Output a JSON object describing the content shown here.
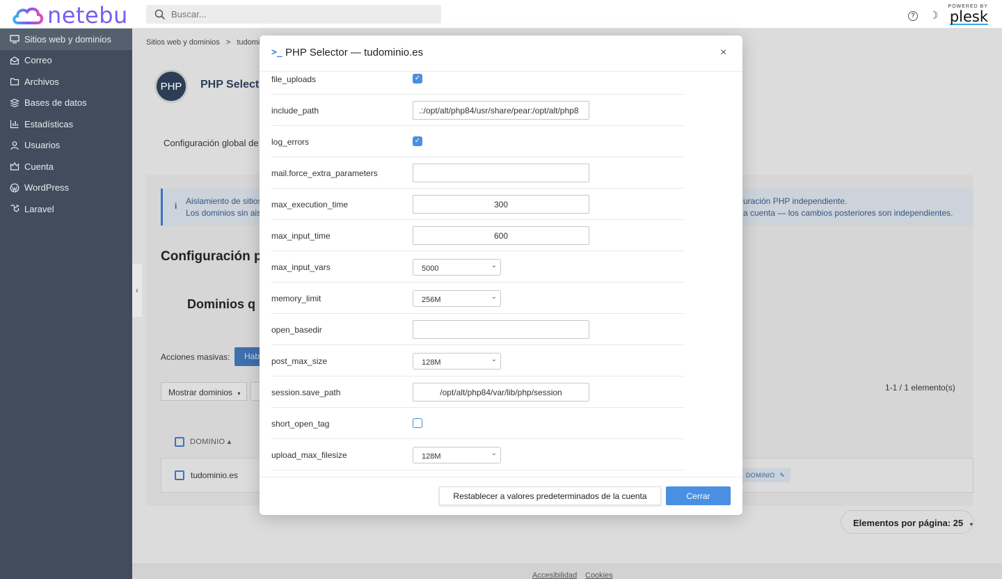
{
  "brand": {
    "name": "netebu",
    "powered_by": "POWERED BY",
    "plesk": "plesk"
  },
  "search": {
    "placeholder": "Buscar..."
  },
  "sidebar": {
    "items": [
      {
        "label": "Sitios web y dominios",
        "icon": "monitor-icon"
      },
      {
        "label": "Correo",
        "icon": "mail-icon"
      },
      {
        "label": "Archivos",
        "icon": "folder-icon"
      },
      {
        "label": "Bases de datos",
        "icon": "database-icon"
      },
      {
        "label": "Estadísticas",
        "icon": "chart-icon"
      },
      {
        "label": "Usuarios",
        "icon": "user-icon"
      },
      {
        "label": "Cuenta",
        "icon": "account-icon"
      },
      {
        "label": "WordPress",
        "icon": "wordpress-icon"
      },
      {
        "label": "Laravel",
        "icon": "laravel-icon"
      }
    ]
  },
  "page": {
    "breadcrumb_1": "Sitios web y dominios",
    "breadcrumb_sep": ">",
    "breadcrumb_2": "tudomin",
    "php_logo": "PHP",
    "title": "PHP Select",
    "subtitle": "Configuración global de l",
    "alert_icon": "i",
    "alert_line1_left": "Aislamiento de sitios",
    "alert_line2_left": "Los dominios sin aisl",
    "alert_line1_right": "uración PHP independiente.",
    "alert_line2_right": "a cuenta — los cambios posteriores son independientes.",
    "section_title": "Configuración p",
    "section_title2": "Dominios q",
    "mass_actions": "Acciones masivas:",
    "mass_button": "Hab",
    "show_domains": "Mostrar dominios",
    "dropdown_marker": "▾",
    "count": "1-1 / 1 elemento(s)",
    "col_domain": "DOMINIO ▴",
    "row_domain": "tudominio.es",
    "row_tag": "DOMINIO",
    "per_page": "Elementos por página: 25",
    "footer_accessibility": "Accesibilidad",
    "footer_cookies": "Cookies"
  },
  "modal": {
    "icon": ">_",
    "title": "PHP Selector — tudominio.es",
    "close": "×",
    "options": [
      {
        "name": "file_uploads",
        "type": "checkbox",
        "checked": true
      },
      {
        "name": "include_path",
        "type": "text",
        "value": ".:/opt/alt/php84/usr/share/pear:/opt/alt/php8"
      },
      {
        "name": "log_errors",
        "type": "checkbox",
        "checked": true
      },
      {
        "name": "mail.force_extra_parameters",
        "type": "text",
        "value": ""
      },
      {
        "name": "max_execution_time",
        "type": "text",
        "value": "300"
      },
      {
        "name": "max_input_time",
        "type": "text",
        "value": "600"
      },
      {
        "name": "max_input_vars",
        "type": "select",
        "value": "5000"
      },
      {
        "name": "memory_limit",
        "type": "select",
        "value": "256M"
      },
      {
        "name": "open_basedir",
        "type": "text",
        "value": ""
      },
      {
        "name": "post_max_size",
        "type": "select",
        "value": "128M"
      },
      {
        "name": "session.save_path",
        "type": "text",
        "value": "/opt/alt/php84/var/lib/php/session"
      },
      {
        "name": "short_open_tag",
        "type": "checkbox",
        "checked": false
      },
      {
        "name": "upload_max_filesize",
        "type": "select",
        "value": "128M"
      }
    ],
    "reset_button": "Restablecer a valores predeterminados de la cuenta",
    "close_button": "Cerrar"
  },
  "colors": {
    "accent": "#4a90e2",
    "sidebar": "#414c5c",
    "brand": "#7a5cf0"
  }
}
